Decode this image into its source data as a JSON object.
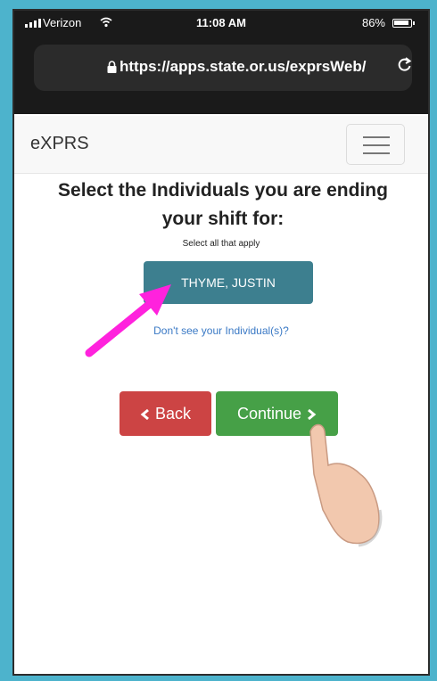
{
  "status_bar": {
    "carrier": "Verizon",
    "time": "11:08 AM",
    "battery": "86%"
  },
  "browser": {
    "url": "https://apps.state.or.us/exprsWeb/"
  },
  "navbar": {
    "brand": "eXPRS"
  },
  "main": {
    "heading_line1": "Select the Individuals you are ending",
    "heading_line2": "your shift for:",
    "hint": "Select all that apply",
    "individual": "THYME, JUSTIN",
    "help_link": "Don't see your Individual(s)?",
    "back_label": "Back",
    "continue_label": "Continue"
  },
  "colors": {
    "border": "#4db3cc",
    "individual_button": "#3d7f8f",
    "back_button": "#cc4444",
    "continue_button": "#46a047",
    "link": "#3a79c5",
    "annotation_arrow": "#ff22dd",
    "pointer_hand": "#f2c8ae"
  },
  "annotations": {
    "arrow_icon": "magenta-arrow-icon",
    "pointer_icon": "hand-pointer-icon"
  }
}
